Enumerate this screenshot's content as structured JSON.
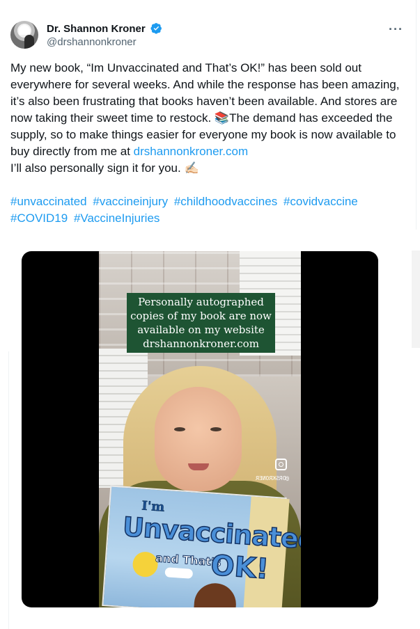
{
  "author": {
    "name": "Dr. Shannon Kroner",
    "handle": "@drshannonkroner",
    "verified": true,
    "avatar": "avatar-capitol-icon"
  },
  "more_menu": "···",
  "tweet": {
    "text_before_link": "My new book, “Im Unvaccinated and That’s OK!” has been sold out everywhere for several weeks. And while the response has been amazing, it’s also been frustrating that books haven’t been available. And stores are now taking their sweet time to restock. 📚The demand has exceeded the supply, so to make things easier for everyone my book is now available to buy directly from me at ",
    "link": "drshannonkroner.com",
    "text_after_link": "I’ll also personally sign it for you. ✍🏻",
    "hashtags": [
      "#unvaccinated",
      "#vaccineinjury",
      "#childhoodvaccines",
      "#covidvaccine",
      "#COVID19",
      "#VaccineInjuries"
    ]
  },
  "media": {
    "caption": "Personally autographed copies of my book are now available on my website drshannonkroner.com",
    "watermark": "@DRSKRONER",
    "book": {
      "line1": "I'm",
      "line2": "Unvaccinated",
      "line3": "and That's",
      "line4": "OK!"
    }
  },
  "colors": {
    "link": "#1d9bf0",
    "text": "#0f1419",
    "muted": "#536471",
    "caption_bg": "#1e5433"
  }
}
